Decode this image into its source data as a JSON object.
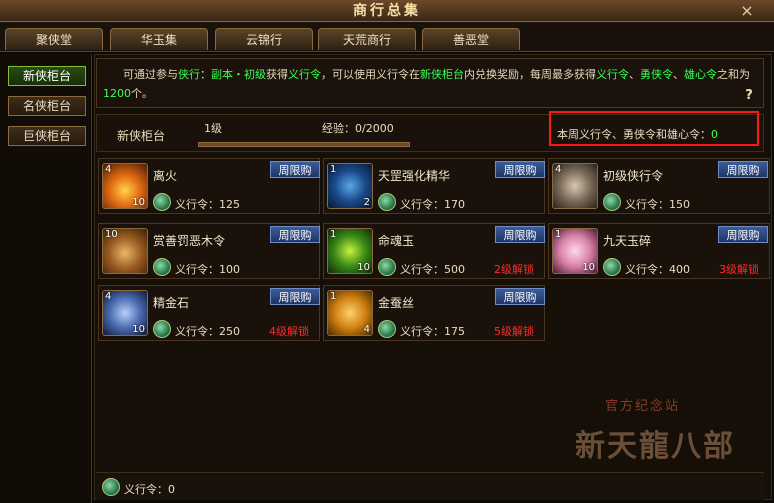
{
  "window": {
    "title": "商行总集",
    "close_label": "×"
  },
  "tabs": [
    "聚侠堂",
    "华玉集",
    "云锦行",
    "天荒商行",
    "善恶堂"
  ],
  "sidebar": [
    "新侠柜台",
    "名侠柜台",
    "巨侠柜台"
  ],
  "description": {
    "part1": "可通过参与",
    "link1": "侠行",
    "part2": "：",
    "link2": "副本・初级",
    "part3": "获得",
    "link3": "义行令",
    "part4": "，可以使用义行令在",
    "link4": "新侠柜台",
    "part5": "内兑换奖励，每周最多获得",
    "link5": "义行令",
    "part6": "、",
    "link6": "勇侠令",
    "part7": "、",
    "link7": "雄心令",
    "part8": "之和为",
    "link8": "1200",
    "part9": "个。",
    "help": "?"
  },
  "info": {
    "counter_label": "新侠柜台",
    "level": "1级",
    "exp": "经验：0/2000",
    "exp_fraction": 0,
    "weekly_label": "本周义行令、勇侠令和雄心令：",
    "weekly_value": "0"
  },
  "items": [
    {
      "name": "离火",
      "qty_top": "4",
      "qty": "10",
      "price": "义行令：125",
      "badge": "周限购",
      "lock": ""
    },
    {
      "name": "天罡强化精华",
      "qty_top": "1",
      "qty": "2",
      "price": "义行令：170",
      "badge": "周限购",
      "lock": ""
    },
    {
      "name": "初级侠行令",
      "qty_top": "4",
      "qty": "",
      "price": "义行令：150",
      "badge": "周限购",
      "lock": ""
    },
    {
      "name": "赏善罚恶木令",
      "qty_top": "10",
      "qty": "",
      "price": "义行令：100",
      "badge": "周限购",
      "lock": ""
    },
    {
      "name": "命魂玉",
      "qty_top": "1",
      "qty": "10",
      "price": "义行令：500",
      "badge": "周限购",
      "lock": "2级解锁"
    },
    {
      "name": "九天玉碎",
      "qty_top": "1",
      "qty": "10",
      "price": "义行令：400",
      "badge": "周限购",
      "lock": "3级解锁"
    },
    {
      "name": "精金石",
      "qty_top": "4",
      "qty": "10",
      "price": "义行令：250",
      "badge": "周限购",
      "lock": "4级解锁"
    },
    {
      "name": "金蚕丝",
      "qty_top": "1",
      "qty": "4",
      "price": "义行令：175",
      "badge": "周限购",
      "lock": "5级解锁"
    }
  ],
  "footer": {
    "balance": "义行令：0"
  },
  "watermark": {
    "top": "官方纪念站",
    "main": "新天龍八部"
  }
}
